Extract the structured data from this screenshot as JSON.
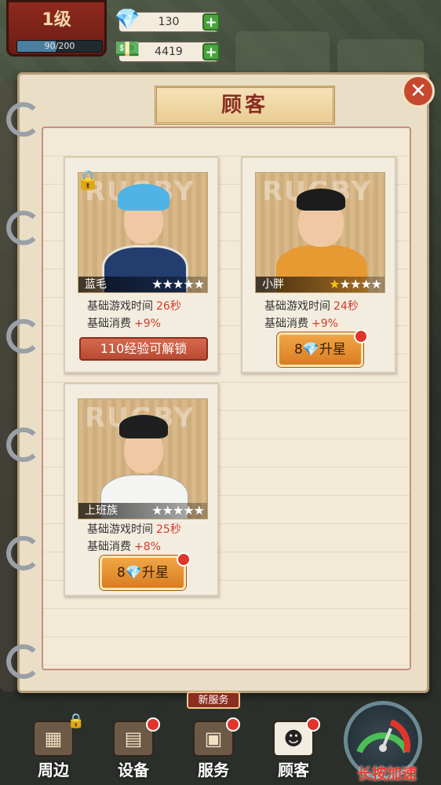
{
  "hud": {
    "level": "1级",
    "xp_text": "90/200",
    "xp_fraction": 0.45,
    "diamonds": "130",
    "cash": "4419",
    "plus": "+"
  },
  "panel": {
    "title": "顾客",
    "close_glyph": "✕"
  },
  "customers": [
    {
      "name": "蓝毛",
      "stars_filled": 0,
      "stars_total": 5,
      "play_time_label": "基础游戏时间",
      "play_time_value": "26秒",
      "spend_label": "基础消费",
      "spend_value": "+9%",
      "locked": true,
      "action_label": "110经验可解锁"
    },
    {
      "name": "小胖",
      "stars_filled": 1,
      "stars_total": 5,
      "play_time_label": "基础游戏时间",
      "play_time_value": "24秒",
      "spend_label": "基础消费",
      "spend_value": "+9%",
      "locked": false,
      "action_cost": "8",
      "action_label": "升星"
    },
    {
      "name": "上班族",
      "stars_filled": 0,
      "stars_total": 5,
      "play_time_label": "基础游戏时间",
      "play_time_value": "25秒",
      "spend_label": "基础消费",
      "spend_value": "+8%",
      "locked": false,
      "action_cost": "8",
      "action_label": "升星"
    }
  ],
  "nav": {
    "items": [
      "周边",
      "设备",
      "服务",
      "顾客"
    ],
    "new_service_tag": "新服务",
    "speed_label": "长按加速"
  },
  "colors": {
    "accent_red": "#8a2d22",
    "value_red": "#d33b2a",
    "star_gold": "#f2c418",
    "button_orange": "#e08a2a"
  }
}
